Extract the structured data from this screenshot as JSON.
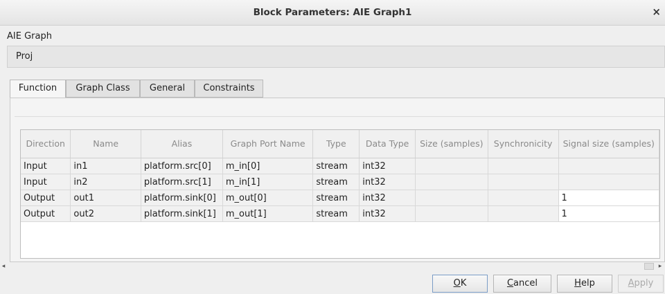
{
  "window": {
    "title": "Block Parameters: AIE Graph1",
    "close": "×"
  },
  "block_type": "AIE Graph",
  "section": "Proj",
  "tabs": [
    {
      "label": "Function",
      "active": true
    },
    {
      "label": "Graph Class",
      "active": false
    },
    {
      "label": "General",
      "active": false
    },
    {
      "label": "Constraints",
      "active": false
    }
  ],
  "table": {
    "columns": [
      "Direction",
      "Name",
      "Alias",
      "Graph Port Name",
      "Type",
      "Data Type",
      "Size (samples)",
      "Synchronicity",
      "Signal size (samples)"
    ],
    "rows": [
      [
        "Input",
        "in1",
        "platform.src[0]",
        "m_in[0]",
        "stream",
        "int32",
        "",
        "",
        ""
      ],
      [
        "Input",
        "in2",
        "platform.src[1]",
        "m_in[1]",
        "stream",
        "int32",
        "",
        "",
        ""
      ],
      [
        "Output",
        "out1",
        "platform.sink[0]",
        "m_out[0]",
        "stream",
        "int32",
        "",
        "",
        "1"
      ],
      [
        "Output",
        "out2",
        "platform.sink[1]",
        "m_out[1]",
        "stream",
        "int32",
        "",
        "",
        "1"
      ]
    ]
  },
  "buttons": {
    "ok": {
      "mnemonic": "O",
      "rest": "K"
    },
    "cancel": {
      "mnemonic": "C",
      "rest": "ancel"
    },
    "help": {
      "mnemonic": "H",
      "rest": "elp"
    },
    "apply": {
      "mnemonic": "A",
      "rest": "pply",
      "disabled": true
    }
  },
  "icons": {
    "close": "close-icon",
    "scroll_left": "arrow-left-icon",
    "scroll_right": "arrow-right-icon"
  }
}
